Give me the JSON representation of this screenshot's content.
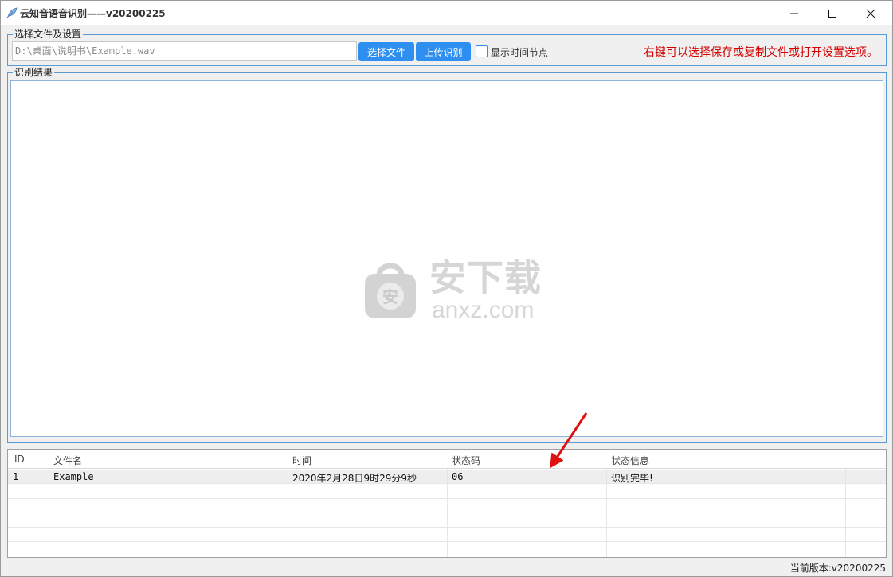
{
  "window": {
    "title": "云知音语音识别——v20200225",
    "icon": "feather-icon"
  },
  "file_group": {
    "legend": "选择文件及设置",
    "path_value": "D:\\桌面\\说明书\\Example.wav",
    "select_button": "选择文件",
    "upload_button": "上传识别",
    "show_time_label": "显示时间节点",
    "show_time_checked": false,
    "hint": "右键可以选择保存或复制文件或打开设置选项。"
  },
  "result_group": {
    "legend": "识别结果"
  },
  "watermark": {
    "cn": "安下载",
    "en": "anxz.com",
    "bag_char": "安"
  },
  "table": {
    "columns": [
      "ID",
      "文件名",
      "时间",
      "状态码",
      "状态信息"
    ],
    "rows": [
      {
        "id": "1",
        "filename": "Example",
        "time": "2020年2月28日9时29分9秒",
        "code": "06",
        "info": "识别完毕!"
      }
    ]
  },
  "footer": {
    "version": "当前版本:v20200225"
  },
  "colors": {
    "accent": "#2f8ff0",
    "hint": "#d40000",
    "group_border": "#5b9bd5"
  }
}
